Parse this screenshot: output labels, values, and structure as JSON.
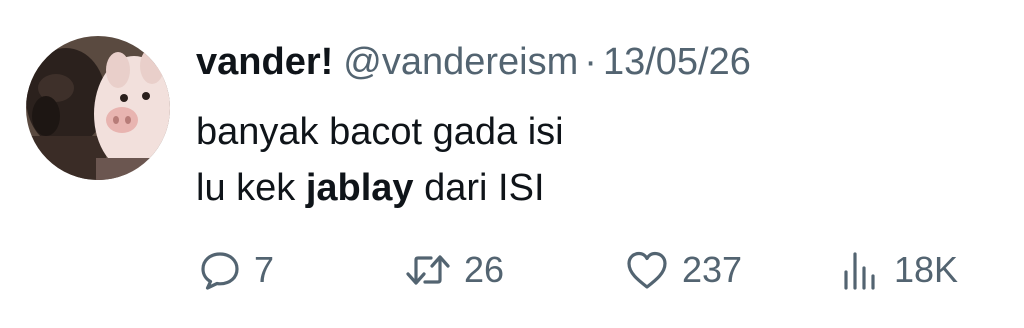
{
  "author": {
    "display_name": "vander!",
    "handle": "@vandereism",
    "separator": "·",
    "date": "13/05/26"
  },
  "body": {
    "line1": "banyak bacot gada isi",
    "line2_prefix": "lu kek ",
    "line2_bold": "jablay",
    "line2_suffix": " dari ISI"
  },
  "actions": {
    "replies": {
      "icon": "reply-icon",
      "count": "7"
    },
    "retweets": {
      "icon": "retweet-icon",
      "count": "26"
    },
    "likes": {
      "icon": "heart-icon",
      "count": "237"
    },
    "views": {
      "icon": "views-icon",
      "count": "18K"
    }
  },
  "colors": {
    "text_primary": "#0f1419",
    "text_secondary": "#536471",
    "background": "#ffffff"
  }
}
